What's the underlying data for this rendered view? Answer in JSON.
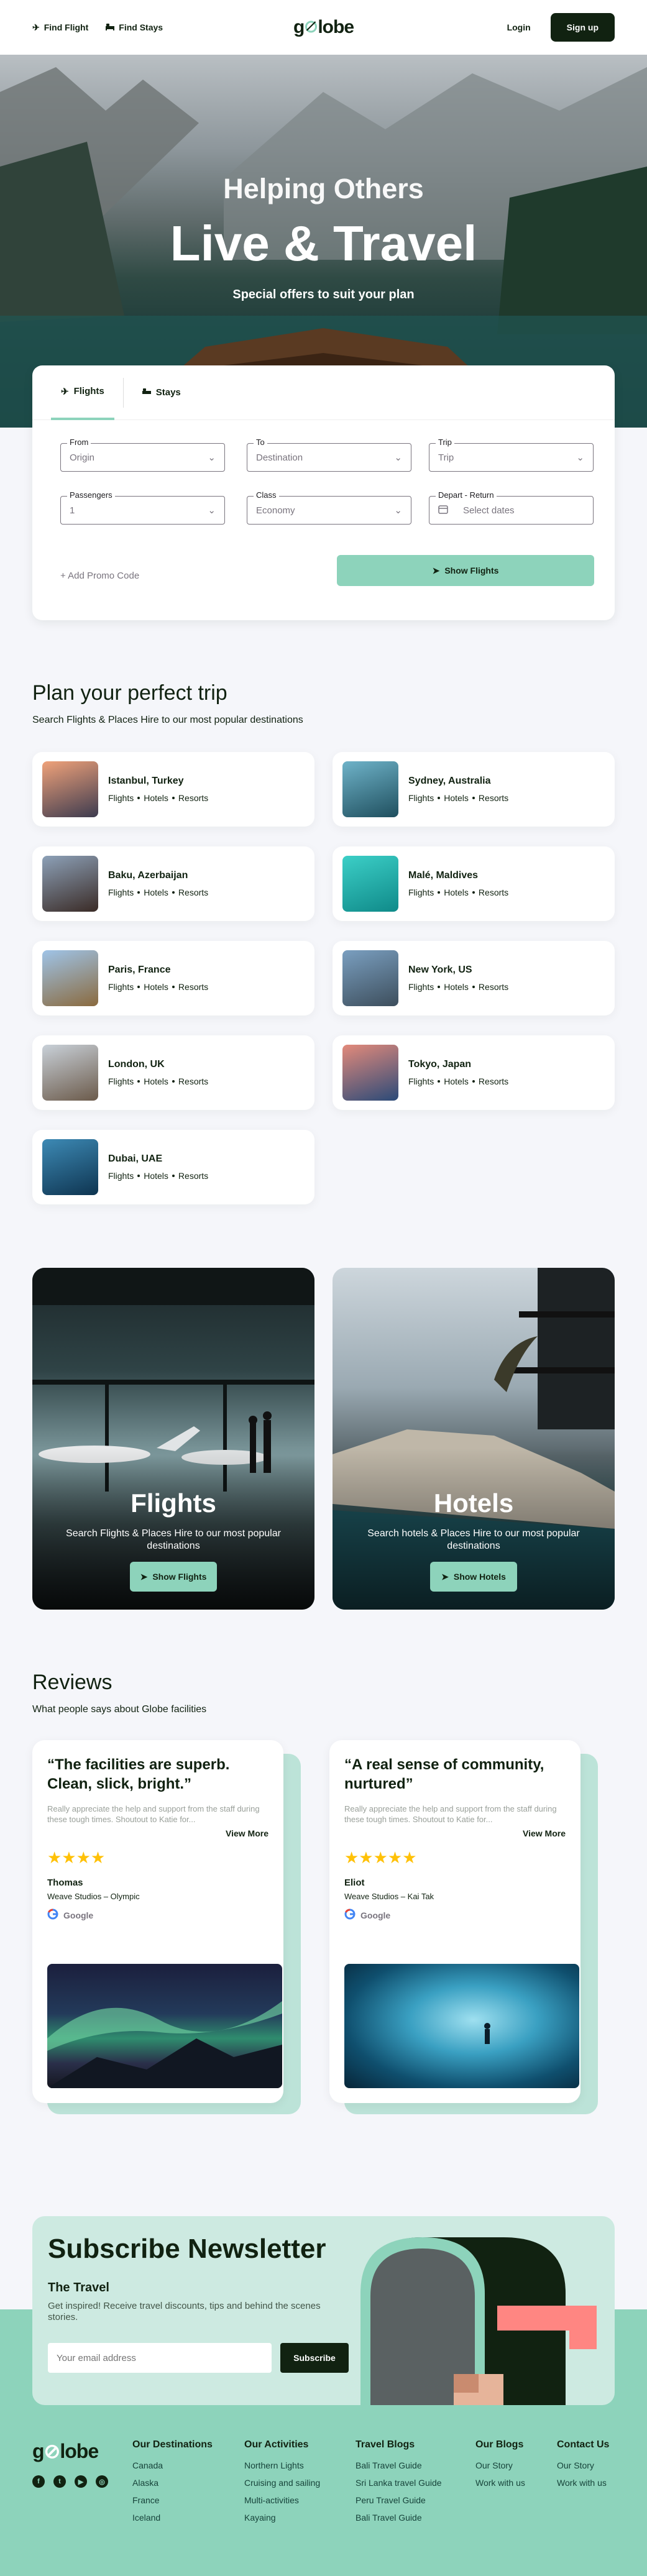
{
  "header": {
    "nav": [
      "Find Flight",
      "Find Stays"
    ],
    "logo_pre": "g",
    "logo_post": "lobe",
    "login": "Login",
    "signup": "Sign up"
  },
  "hero": {
    "line1": "Helping Others",
    "line2": "Live & Travel",
    "line3": "Special offers to suit your plan"
  },
  "search": {
    "tabs": [
      "Flights",
      "Stays"
    ],
    "from": {
      "label": "From",
      "placeholder": "Origin"
    },
    "to": {
      "label": "To",
      "placeholder": "Destination"
    },
    "trip": {
      "label": "Trip",
      "placeholder": "Trip"
    },
    "passengers": {
      "label": "Passengers",
      "value": "1"
    },
    "class": {
      "label": "Class",
      "placeholder": "Economy"
    },
    "dates": {
      "label": "Depart - Return",
      "placeholder": "Select dates"
    },
    "promo": "+ Add Promo Code",
    "submit": "Show Flights"
  },
  "plan": {
    "title": "Plan your perfect trip",
    "subtitle": "Search Flights & Places Hire to our most popular destinations",
    "tags": [
      "Flights",
      "Hotels",
      "Resorts"
    ],
    "destinations": [
      {
        "name": "Istanbul, Turkey",
        "c1": "#f0a27a",
        "c2": "#3d3b4f"
      },
      {
        "name": "Sydney, Australia",
        "c1": "#6fb3c9",
        "c2": "#1f4f5e"
      },
      {
        "name": "Baku, Azerbaijan",
        "c1": "#8da1b8",
        "c2": "#3a2b26"
      },
      {
        "name": "Malé, Maldives",
        "c1": "#3ccfc7",
        "c2": "#0f8a89"
      },
      {
        "name": "Paris, France",
        "c1": "#9fc4e8",
        "c2": "#8a6a3e"
      },
      {
        "name": "New York, US",
        "c1": "#7a9fc0",
        "c2": "#3d4e5c"
      },
      {
        "name": "London, UK",
        "c1": "#c9d1d9",
        "c2": "#6b5a4a"
      },
      {
        "name": "Tokyo, Japan",
        "c1": "#e38a7b",
        "c2": "#2b4a78"
      },
      {
        "name": "Dubai, UAE",
        "c1": "#3d8ab5",
        "c2": "#0e3450"
      }
    ]
  },
  "cards": [
    {
      "title": "Flights",
      "desc": "Search Flights & Places Hire to our most popular destinations",
      "button": "Show Flights"
    },
    {
      "title": "Hotels",
      "desc": "Search hotels & Places Hire to our most popular destinations",
      "button": "Show Hotels"
    }
  ],
  "reviews": {
    "title": "Reviews",
    "subtitle": "What people says about Globe facilities",
    "items": [
      {
        "quote": "“The facilities are superb. Clean, slick, bright.”",
        "body": "Really appreciate the help and support from the staff during these tough times. Shoutout to Katie for...",
        "more": "View More",
        "stars": "★★★★",
        "name": "Thomas",
        "company": "Weave Studios – Olympic",
        "source": "Google"
      },
      {
        "quote": "“A real sense of community, nurtured”",
        "body": "Really appreciate the help and support from the staff during these tough times. Shoutout to Katie for...",
        "more": "View More",
        "stars": "★★★★★",
        "name": "Eliot",
        "company": "Weave Studios – Kai Tak",
        "source": "Google"
      }
    ]
  },
  "newsletter": {
    "title": "Subscribe Newsletter",
    "subtitle": "The Travel",
    "desc": "Get inspired! Receive travel discounts, tips and behind the scenes stories.",
    "placeholder": "Your email address",
    "button": "Subscribe"
  },
  "footer": {
    "logo_pre": "g",
    "logo_post": "lobe",
    "columns": [
      {
        "title": "Our Destinations",
        "items": [
          "Canada",
          "Alaska",
          "France",
          "Iceland"
        ]
      },
      {
        "title": "Our Activities",
        "items": [
          "Northern Lights",
          "Cruising and sailing",
          "Multi-activities",
          "Kayaing"
        ]
      },
      {
        "title": "Travel Blogs",
        "items": [
          "Bali Travel Guide",
          "Sri Lanka travel Guide",
          "Peru Travel Guide",
          "Bali Travel Guide"
        ]
      },
      {
        "title": "Our Blogs",
        "items": [
          "Our Story",
          "Work with us"
        ]
      },
      {
        "title": "Contact Us",
        "items": [
          "Our Story",
          "Work with us"
        ]
      }
    ]
  },
  "colors": {
    "accent": "#8dd3bb",
    "dark": "#112211",
    "star": "#ffc107"
  }
}
